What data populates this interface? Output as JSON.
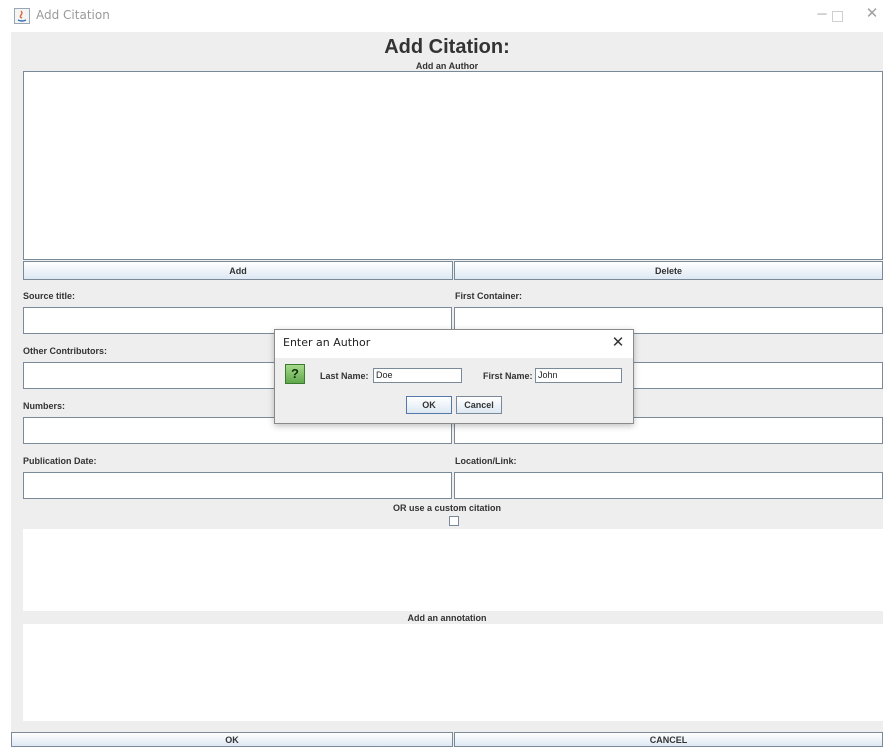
{
  "window": {
    "title": "Add Citation"
  },
  "form": {
    "title": "Add Citation:",
    "authors_label": "Add an Author",
    "add_button": "Add",
    "delete_button": "Delete",
    "source_title_label": "Source title:",
    "source_title_value": "",
    "first_container_label": "First Container:",
    "first_container_value": "",
    "other_contributors_label": "Other Contributors:",
    "other_contributors_value": "",
    "numbers_label": "Numbers:",
    "numbers_value": "",
    "publication_date_label": "Publication Date:",
    "publication_date_value": "",
    "location_link_label": "Location/Link:",
    "location_link_value": "",
    "custom_citation_label": "OR use a custom citation",
    "custom_citation_checked": false,
    "annotation_label": "Add an annotation",
    "ok_button": "OK",
    "cancel_button": "CANCEL"
  },
  "dialog": {
    "title": "Enter an Author",
    "icon": "question-icon",
    "icon_glyph": "?",
    "last_name_label": "Last Name:",
    "last_name_value": "Doe",
    "first_name_label": "First Name:",
    "first_name_value": "John",
    "ok_button": "OK",
    "cancel_button": "Cancel"
  },
  "colors": {
    "panel_bg": "#eeeeee",
    "border": "#7a8a99",
    "button_gradient_bottom": "#dde8f3",
    "question_icon_green": "#5fa84b"
  }
}
